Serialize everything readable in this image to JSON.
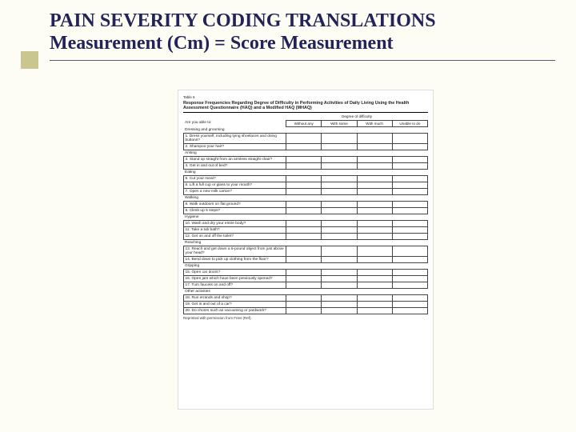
{
  "title": {
    "line1": "PAIN SEVERITY CODING TRANSLATIONS",
    "line2": "Measurement (Cm) = Score Measurement"
  },
  "form": {
    "tableLabel": "Table 6",
    "heading": "Response Frequencies Regarding Degree of Difficulty in Performing Activities of Daily Living Using the Health Assessment Questionnaire (HAQ) and a Modified HAQ (MHAQ)",
    "difficultyHeader": "Degree of difficulty",
    "lead": "Are you able to:",
    "cols": [
      "Without any",
      "With some",
      "With much",
      "Unable to do"
    ],
    "sections": [
      {
        "name": "Dressing and grooming",
        "items": [
          "1. Dress yourself, including tying shoelaces and doing buttons?",
          "2. Shampoo your hair?"
        ]
      },
      {
        "name": "Arising",
        "items": [
          "3. Stand up straight from an armless straight chair?",
          "4. Get in and out of bed?"
        ]
      },
      {
        "name": "Eating",
        "items": [
          "5. Cut your meat?",
          "6. Lift a full cup or glass to your mouth?",
          "7. Open a new milk carton?"
        ]
      },
      {
        "name": "Walking",
        "items": [
          "8. Walk outdoors on flat ground?",
          "9. Climb up 5 steps?"
        ]
      },
      {
        "name": "Hygiene",
        "items": [
          "10. Wash and dry your entire body?",
          "11. Take a tub bath?",
          "12. Get on and off the toilet?"
        ]
      },
      {
        "name": "Reaching",
        "items": [
          "13. Reach and get down a 5-pound object from just above your head?",
          "14. Bend down to pick up clothing from the floor?"
        ]
      },
      {
        "name": "Gripping",
        "items": [
          "15. Open car doors?",
          "16. Open jars which have been previously opened?",
          "17. Turn faucets on and off?"
        ]
      },
      {
        "name": "Other activities",
        "items": [
          "18. Run errands and shop?",
          "19. Get in and out of a car?",
          "20. Do chores such as vacuuming or yardwork?"
        ]
      }
    ],
    "footer": "Reprinted with permission from Fries (Ref)."
  }
}
